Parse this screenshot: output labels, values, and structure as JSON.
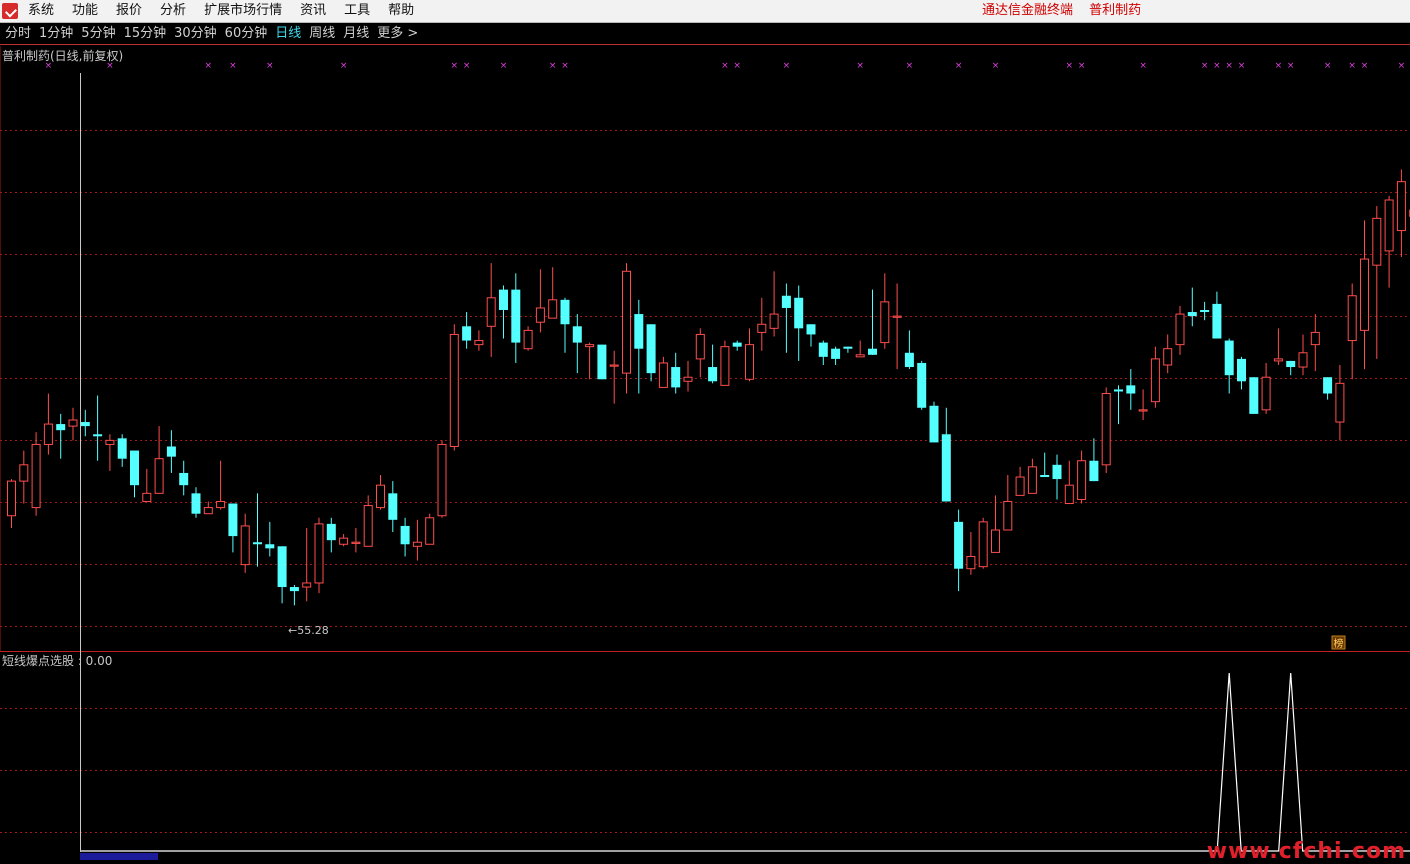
{
  "menubar": {
    "items": [
      "系统",
      "功能",
      "报价",
      "分析",
      "扩展市场行情",
      "资讯",
      "工具",
      "帮助"
    ],
    "terminal_label": "通达信金融终端",
    "stock_name": "普利制药"
  },
  "toolbar": {
    "periods": [
      "分时",
      "1分钟",
      "5分钟",
      "15分钟",
      "30分钟",
      "60分钟",
      "日线",
      "周线",
      "月线",
      "更多 >"
    ],
    "active_period": "日线"
  },
  "main_panel": {
    "title": "普利制药(日线,前复权)",
    "low_label": "←55.28",
    "badge": "榜"
  },
  "indicator_panel": {
    "title": "短线爆点选股 : 0.00"
  },
  "colors": {
    "up": "#ff4d4d",
    "down": "#54ffff",
    "grid": "#a01818",
    "marker": "#e040e0",
    "cursor": "#c8c8c8",
    "signal": "#ffffff"
  },
  "watermark": "www.cfchi.com",
  "chart_data": {
    "type": "candlestick",
    "price_range": [
      54,
      81
    ],
    "candles": [
      [
        60.1,
        61.8,
        61.9,
        59.5
      ],
      [
        61.8,
        62.6,
        63.3,
        60.7
      ],
      [
        60.5,
        63.6,
        64.2,
        60.1
      ],
      [
        63.6,
        64.6,
        66.1,
        63.1
      ],
      [
        64.6,
        64.3,
        65.1,
        62.9
      ],
      [
        64.5,
        64.8,
        65.4,
        63.8
      ],
      [
        64.7,
        64.5,
        65.3,
        64.0
      ],
      [
        64.1,
        64.0,
        66.0,
        62.8
      ],
      [
        63.6,
        63.8,
        64.1,
        62.3
      ],
      [
        63.9,
        62.9,
        64.1,
        62.5
      ],
      [
        63.3,
        61.6,
        63.3,
        61.0
      ],
      [
        60.8,
        61.2,
        62.4,
        60.8
      ],
      [
        61.2,
        62.9,
        64.5,
        61.5
      ],
      [
        63.5,
        63.0,
        64.3,
        62.2
      ],
      [
        62.2,
        61.6,
        62.8,
        61.1
      ],
      [
        61.2,
        60.2,
        61.5,
        60.0
      ],
      [
        60.2,
        60.5,
        60.8,
        60.3
      ],
      [
        60.5,
        60.8,
        62.8,
        60.4
      ],
      [
        60.7,
        59.1,
        60.7,
        58.3
      ],
      [
        57.7,
        59.6,
        60.2,
        57.3
      ],
      [
        58.8,
        58.7,
        61.2,
        57.6
      ],
      [
        58.7,
        58.5,
        59.8,
        58.1
      ],
      [
        58.6,
        56.6,
        58.6,
        55.8
      ],
      [
        56.6,
        56.4,
        56.7,
        55.7
      ],
      [
        56.6,
        56.8,
        59.5,
        55.9
      ],
      [
        56.8,
        59.7,
        60.0,
        56.3
      ],
      [
        59.7,
        58.9,
        60.0,
        58.3
      ],
      [
        58.7,
        59.0,
        59.2,
        58.6
      ],
      [
        58.8,
        58.8,
        59.5,
        58.3
      ],
      [
        58.6,
        60.6,
        61.1,
        58.7
      ],
      [
        60.5,
        61.6,
        62.1,
        60.4
      ],
      [
        61.2,
        59.9,
        61.8,
        59.3
      ],
      [
        59.6,
        58.7,
        60.0,
        58.1
      ],
      [
        58.6,
        58.8,
        59.9,
        57.9
      ],
      [
        58.7,
        60.0,
        60.2,
        58.9
      ],
      [
        60.1,
        63.6,
        63.8,
        60.0
      ],
      [
        63.5,
        69.0,
        69.5,
        63.3
      ],
      [
        69.4,
        68.7,
        70.1,
        68.3
      ],
      [
        68.5,
        68.7,
        69.2,
        68.2
      ],
      [
        69.4,
        70.8,
        72.5,
        67.9
      ],
      [
        71.2,
        70.2,
        71.4,
        68.8
      ],
      [
        71.2,
        68.6,
        72.0,
        67.6
      ],
      [
        68.3,
        69.2,
        69.4,
        68.2
      ],
      [
        69.6,
        70.3,
        72.2,
        69.1
      ],
      [
        69.8,
        70.7,
        72.3,
        69.8
      ],
      [
        70.7,
        69.5,
        70.8,
        68.1
      ],
      [
        69.4,
        68.6,
        70.0,
        67.1
      ],
      [
        68.4,
        68.5,
        68.6,
        66.8
      ],
      [
        68.5,
        66.8,
        67.0,
        67.8
      ],
      [
        67.5,
        67.5,
        68.2,
        65.6
      ],
      [
        67.1,
        72.1,
        72.5,
        66.1
      ],
      [
        70.0,
        68.3,
        70.7,
        66.1
      ],
      [
        69.5,
        67.1,
        69.5,
        66.7
      ],
      [
        66.4,
        67.6,
        67.9,
        66.5
      ],
      [
        67.4,
        66.4,
        68.1,
        66.1
      ],
      [
        66.7,
        66.9,
        67.7,
        66.2
      ],
      [
        67.8,
        69.0,
        69.3,
        66.9
      ],
      [
        67.4,
        66.7,
        68.5,
        66.6
      ],
      [
        66.5,
        68.4,
        68.7,
        66.7
      ],
      [
        68.6,
        68.4,
        68.7,
        68.2
      ],
      [
        66.8,
        68.5,
        69.3,
        66.7
      ],
      [
        69.1,
        69.5,
        70.8,
        68.2
      ],
      [
        69.3,
        70.0,
        72.1,
        68.9
      ],
      [
        70.9,
        70.3,
        71.5,
        68.1
      ],
      [
        70.8,
        69.3,
        71.4,
        67.7
      ],
      [
        69.5,
        69.0,
        69.5,
        68.4
      ],
      [
        68.6,
        67.9,
        68.7,
        67.5
      ],
      [
        68.3,
        67.8,
        68.4,
        67.5
      ],
      [
        68.4,
        68.3,
        68.4,
        68.1
      ],
      [
        67.9,
        68.0,
        68.7,
        67.9
      ],
      [
        68.3,
        68.0,
        71.2,
        68.0
      ],
      [
        68.6,
        70.6,
        72.0,
        68.3
      ],
      [
        69.9,
        69.9,
        71.5,
        67.3
      ],
      [
        68.1,
        67.4,
        69.2,
        67.3
      ],
      [
        67.6,
        65.4,
        67.7,
        65.3
      ],
      [
        65.5,
        63.7,
        65.7,
        63.8
      ],
      [
        64.1,
        60.8,
        65.4,
        63.7
      ],
      [
        59.8,
        57.5,
        60.4,
        56.4
      ],
      [
        57.5,
        58.1,
        59.3,
        57.2
      ],
      [
        57.6,
        59.8,
        60.0,
        57.5
      ],
      [
        58.3,
        59.4,
        61.1,
        58.5
      ],
      [
        59.4,
        60.8,
        62.1,
        59.8
      ],
      [
        61.1,
        62.0,
        62.5,
        61.1
      ],
      [
        61.2,
        62.5,
        62.9,
        61.3
      ],
      [
        62.1,
        62.0,
        63.2,
        62.3
      ],
      [
        62.6,
        61.9,
        63.1,
        60.9
      ],
      [
        60.7,
        61.6,
        62.8,
        60.7
      ],
      [
        60.9,
        62.8,
        63.3,
        60.7
      ],
      [
        62.8,
        61.8,
        63.9,
        61.9
      ],
      [
        62.6,
        66.1,
        66.4,
        62.2
      ],
      [
        66.3,
        66.2,
        66.5,
        64.6
      ],
      [
        66.5,
        66.1,
        67.3,
        65.3
      ],
      [
        65.3,
        65.3,
        66.3,
        64.8
      ],
      [
        65.7,
        67.8,
        68.4,
        65.4
      ],
      [
        67.5,
        68.3,
        69.0,
        67.1
      ],
      [
        68.5,
        70.0,
        70.4,
        68.0
      ],
      [
        70.1,
        69.9,
        71.3,
        69.4
      ],
      [
        70.2,
        70.1,
        70.6,
        69.7
      ],
      [
        70.5,
        68.8,
        71.1,
        68.8
      ],
      [
        68.7,
        67.0,
        68.8,
        66.1
      ],
      [
        67.8,
        66.7,
        67.9,
        66.3
      ],
      [
        66.9,
        65.1,
        66.9,
        65.3
      ],
      [
        65.3,
        66.9,
        67.6,
        65.1
      ],
      [
        67.7,
        67.8,
        69.3,
        67.5
      ],
      [
        67.7,
        67.4,
        67.7,
        67.0
      ],
      [
        67.4,
        68.1,
        69.0,
        67.0
      ],
      [
        68.5,
        69.1,
        70.0,
        67.2
      ],
      [
        66.9,
        66.1,
        66.7,
        65.8
      ],
      [
        64.7,
        66.6,
        67.5,
        63.8
      ],
      [
        68.7,
        70.9,
        71.5,
        66.8
      ],
      [
        69.2,
        72.7,
        74.6,
        67.3
      ],
      [
        72.4,
        74.7,
        75.3,
        67.8
      ],
      [
        73.1,
        75.6,
        75.8,
        71.3
      ],
      [
        74.1,
        76.5,
        77.1,
        72.8
      ],
      [
        74.8,
        75.1,
        76.4,
        72.4
      ],
      [
        75.3,
        75.4,
        76.9,
        73.1
      ]
    ],
    "markers": [
      3,
      8,
      16,
      18,
      21,
      27,
      36,
      37,
      40,
      44,
      45,
      58,
      59,
      63,
      69,
      73,
      77,
      80,
      86,
      87,
      92,
      97,
      98,
      99,
      100,
      103,
      104,
      107,
      109,
      110,
      113
    ],
    "signal_spikes": [
      99,
      104
    ]
  }
}
